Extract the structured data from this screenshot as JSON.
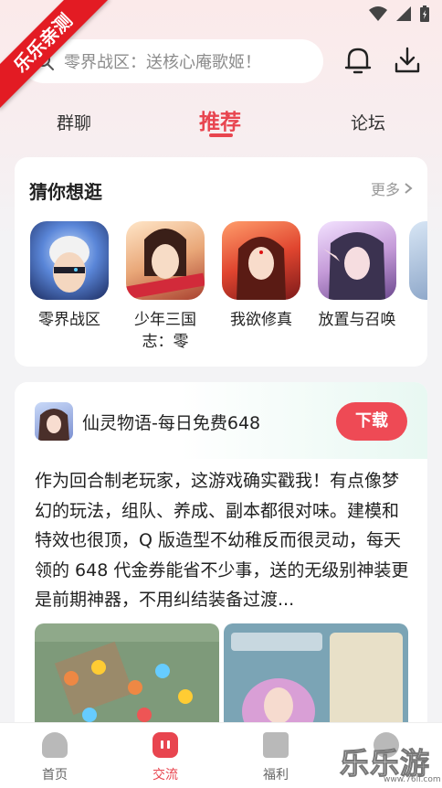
{
  "corner_badge": "乐乐亲测",
  "search": {
    "placeholder": "零界战区：送核心庵歌姬！"
  },
  "tabs": [
    {
      "label": "群聊"
    },
    {
      "label": "推荐"
    },
    {
      "label": "论坛"
    }
  ],
  "guess": {
    "title": "猜你想逛",
    "more_label": "更多",
    "games": [
      {
        "name": "零界战区",
        "icon": "game-icon-lingjie"
      },
      {
        "name": "少年三国志：零",
        "icon": "game-icon-sanguo"
      },
      {
        "name": "我欲修真",
        "icon": "game-icon-xiuzhen"
      },
      {
        "name": "放置与召唤",
        "icon": "game-icon-zhaohuan"
      }
    ]
  },
  "post": {
    "game_title": "仙灵物语-每日免费648",
    "download_label": "下载",
    "body": "作为回合制老玩家，这游戏确实戳我！有点像梦幻的玩法，组队、养成、副本都很对味。建模和特效也很顶，Q 版造型不幼稚反而很灵动，每天领的 648 代金券能省不少事，送的无级别神装更是前期神器，不用纠结装备过渡..."
  },
  "bottom_nav": [
    {
      "label": "首页",
      "icon": "home-icon"
    },
    {
      "label": "交流",
      "icon": "chat-icon"
    },
    {
      "label": "福利",
      "icon": "gift-icon"
    }
  ],
  "watermark": {
    "text": "乐乐游戏",
    "url": "www.76ll.com"
  },
  "colors": {
    "accent": "#e8454f",
    "download": "#ee4a55",
    "badge": "#e31b23"
  }
}
